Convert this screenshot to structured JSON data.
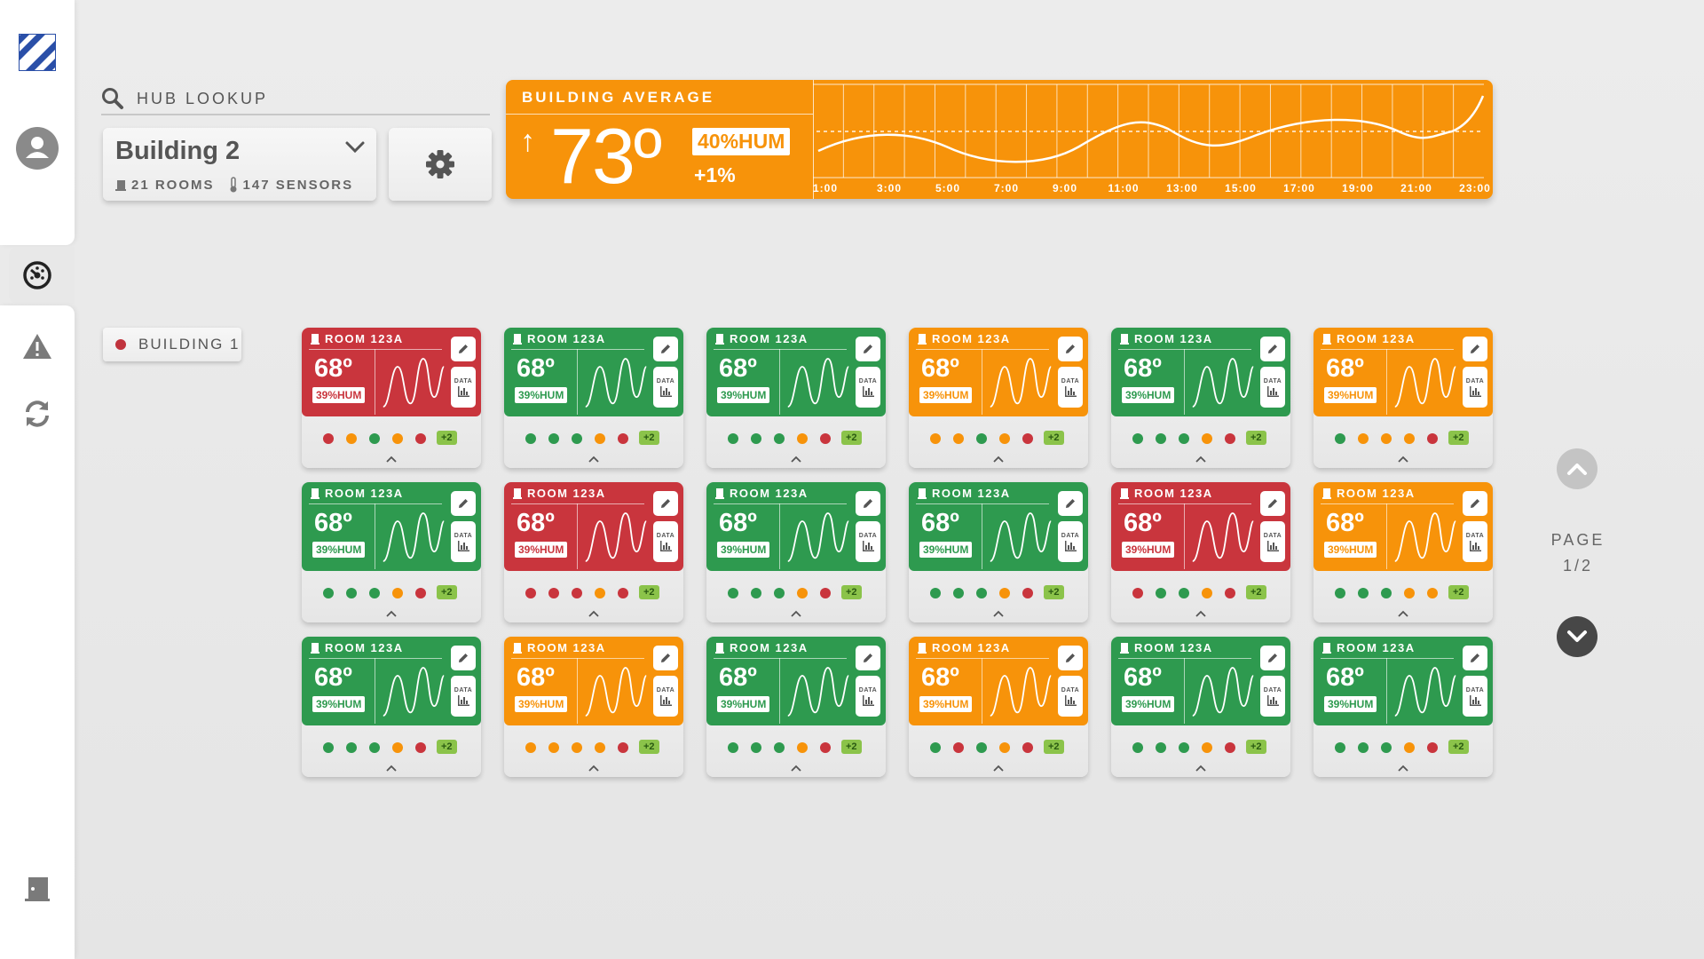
{
  "sidebar": {
    "logo": "logo-icon",
    "items": [
      {
        "name": "profile",
        "icon": "user-icon"
      },
      {
        "name": "dashboard",
        "icon": "gauge-icon",
        "active": true
      },
      {
        "name": "alerts",
        "icon": "warning-icon"
      },
      {
        "name": "sync",
        "icon": "refresh-icon"
      },
      {
        "name": "logout",
        "icon": "exit-door-icon"
      }
    ]
  },
  "search": {
    "label": "HUB LOOKUP"
  },
  "building_select": {
    "name": "Building 2",
    "rooms": "21 ROOMS",
    "sensors": "147 SENSORS"
  },
  "building_average": {
    "label": "BUILDING AVERAGE",
    "trend": "↑",
    "temperature": "73º",
    "humidity": "40%HUM",
    "change": "+1%",
    "times": [
      "1:00",
      "3:00",
      "5:00",
      "7:00",
      "9:00",
      "11:00",
      "13:00",
      "15:00",
      "17:00",
      "19:00",
      "21:00",
      "23:00"
    ],
    "color": "#f7930a"
  },
  "building_filter": {
    "label": "BUILDING 1",
    "status_color": "#c0333d"
  },
  "colors": {
    "red": "#c9353d",
    "green": "#2e9a4f",
    "orange": "#f7930a",
    "badge": "#8bc34a"
  },
  "rooms": [
    {
      "name": "ROOM 123A",
      "temp": "68º",
      "hum": "39%HUM",
      "status": "red",
      "dots": [
        "red",
        "orange",
        "green",
        "orange",
        "red"
      ],
      "more": "+2",
      "data_label": "DATA"
    },
    {
      "name": "ROOM 123A",
      "temp": "68º",
      "hum": "39%HUM",
      "status": "green",
      "dots": [
        "green",
        "green",
        "green",
        "orange",
        "red"
      ],
      "more": "+2",
      "data_label": "DATA"
    },
    {
      "name": "ROOM 123A",
      "temp": "68º",
      "hum": "39%HUM",
      "status": "green",
      "dots": [
        "green",
        "green",
        "green",
        "orange",
        "red"
      ],
      "more": "+2",
      "data_label": "DATA"
    },
    {
      "name": "ROOM 123A",
      "temp": "68º",
      "hum": "39%HUM",
      "status": "orange",
      "dots": [
        "orange",
        "orange",
        "green",
        "orange",
        "red"
      ],
      "more": "+2",
      "data_label": "DATA"
    },
    {
      "name": "ROOM 123A",
      "temp": "68º",
      "hum": "39%HUM",
      "status": "green",
      "dots": [
        "green",
        "green",
        "green",
        "orange",
        "red"
      ],
      "more": "+2",
      "data_label": "DATA"
    },
    {
      "name": "ROOM 123A",
      "temp": "68º",
      "hum": "39%HUM",
      "status": "orange",
      "dots": [
        "green",
        "orange",
        "orange",
        "orange",
        "red"
      ],
      "more": "+2",
      "data_label": "DATA"
    },
    {
      "name": "ROOM 123A",
      "temp": "68º",
      "hum": "39%HUM",
      "status": "green",
      "dots": [
        "green",
        "green",
        "green",
        "orange",
        "red"
      ],
      "more": "+2",
      "data_label": "DATA"
    },
    {
      "name": "ROOM 123A",
      "temp": "68º",
      "hum": "39%HUM",
      "status": "red",
      "dots": [
        "red",
        "red",
        "red",
        "orange",
        "red"
      ],
      "more": "+2",
      "data_label": "DATA"
    },
    {
      "name": "ROOM 123A",
      "temp": "68º",
      "hum": "39%HUM",
      "status": "green",
      "dots": [
        "green",
        "green",
        "green",
        "orange",
        "red"
      ],
      "more": "+2",
      "data_label": "DATA"
    },
    {
      "name": "ROOM 123A",
      "temp": "68º",
      "hum": "39%HUM",
      "status": "green",
      "dots": [
        "green",
        "green",
        "green",
        "orange",
        "red"
      ],
      "more": "+2",
      "data_label": "DATA"
    },
    {
      "name": "ROOM 123A",
      "temp": "68º",
      "hum": "39%HUM",
      "status": "red",
      "dots": [
        "red",
        "green",
        "green",
        "orange",
        "red"
      ],
      "more": "+2",
      "data_label": "DATA"
    },
    {
      "name": "ROOM 123A",
      "temp": "68º",
      "hum": "39%HUM",
      "status": "orange",
      "dots": [
        "green",
        "green",
        "green",
        "orange",
        "orange"
      ],
      "more": "+2",
      "data_label": "DATA"
    },
    {
      "name": "ROOM 123A",
      "temp": "68º",
      "hum": "39%HUM",
      "status": "green",
      "dots": [
        "green",
        "green",
        "green",
        "orange",
        "red"
      ],
      "more": "+2",
      "data_label": "DATA"
    },
    {
      "name": "ROOM 123A",
      "temp": "68º",
      "hum": "39%HUM",
      "status": "orange",
      "dots": [
        "orange",
        "orange",
        "orange",
        "orange",
        "red"
      ],
      "more": "+2",
      "data_label": "DATA"
    },
    {
      "name": "ROOM 123A",
      "temp": "68º",
      "hum": "39%HUM",
      "status": "green",
      "dots": [
        "green",
        "green",
        "green",
        "orange",
        "red"
      ],
      "more": "+2",
      "data_label": "DATA"
    },
    {
      "name": "ROOM 123A",
      "temp": "68º",
      "hum": "39%HUM",
      "status": "orange",
      "dots": [
        "green",
        "red",
        "green",
        "orange",
        "red"
      ],
      "more": "+2",
      "data_label": "DATA"
    },
    {
      "name": "ROOM 123A",
      "temp": "68º",
      "hum": "39%HUM",
      "status": "green",
      "dots": [
        "green",
        "green",
        "green",
        "orange",
        "red"
      ],
      "more": "+2",
      "data_label": "DATA"
    },
    {
      "name": "ROOM 123A",
      "temp": "68º",
      "hum": "39%HUM",
      "status": "green",
      "dots": [
        "green",
        "green",
        "green",
        "orange",
        "red"
      ],
      "more": "+2",
      "data_label": "DATA"
    }
  ],
  "pagination": {
    "label": "PAGE",
    "current": "1/2"
  }
}
